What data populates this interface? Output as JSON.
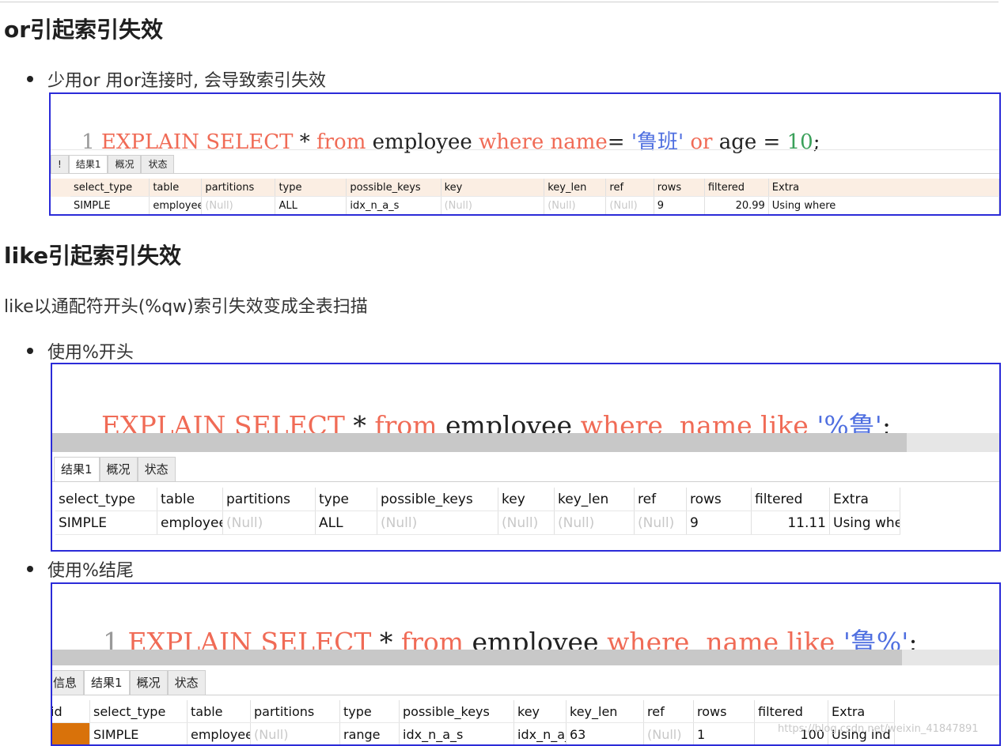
{
  "section1": {
    "heading": "or引起索引失效",
    "bullet": "少用or 用or连接时, 会导致索引失效",
    "shot": {
      "line_no": "1",
      "sql": [
        {
          "t": "EXPLAIN",
          "c": "kw"
        },
        {
          "t": " ",
          "c": "op"
        },
        {
          "t": "SELECT",
          "c": "kw"
        },
        {
          "t": " * ",
          "c": "op"
        },
        {
          "t": "from",
          "c": "kw"
        },
        {
          "t": " employee ",
          "c": "op"
        },
        {
          "t": "where",
          "c": "kw"
        },
        {
          "t": " ",
          "c": "op"
        },
        {
          "t": "name",
          "c": "kw"
        },
        {
          "t": "= ",
          "c": "op"
        },
        {
          "t": "'鲁班'",
          "c": "str"
        },
        {
          "t": " ",
          "c": "op"
        },
        {
          "t": "or",
          "c": "kw"
        },
        {
          "t": " age = ",
          "c": "op"
        },
        {
          "t": "10",
          "c": "num"
        },
        {
          "t": ";",
          "c": "op"
        }
      ],
      "tabs": [
        "!",
        "结果1",
        "概况",
        "状态"
      ],
      "columns": [
        "select_type",
        "table",
        "partitions",
        "type",
        "possible_keys",
        "key",
        "key_len",
        "ref",
        "rows",
        "filtered",
        "Extra"
      ],
      "row": [
        "SIMPLE",
        "employee",
        "(Null)",
        "ALL",
        "idx_n_a_s",
        "(Null)",
        "(Null)",
        "(Null)",
        "9",
        "20.99",
        "Using where"
      ]
    }
  },
  "section2": {
    "heading": "like引起索引失效",
    "para": "like以通配符开头(%qw)索引失效变成全表扫描",
    "bullet_a": "使用%开头",
    "shot_a": {
      "sql": [
        {
          "t": "EXPLAIN",
          "c": "kw"
        },
        {
          "t": " ",
          "c": "op"
        },
        {
          "t": "SELECT",
          "c": "kw"
        },
        {
          "t": " * ",
          "c": "op"
        },
        {
          "t": "from",
          "c": "kw"
        },
        {
          "t": " employee ",
          "c": "op"
        },
        {
          "t": "where",
          "c": "kw"
        },
        {
          "t": "  ",
          "c": "op"
        },
        {
          "t": "name",
          "c": "kw"
        },
        {
          "t": " ",
          "c": "op"
        },
        {
          "t": "like",
          "c": "kw"
        },
        {
          "t": " ",
          "c": "op"
        },
        {
          "t": "'%鲁'",
          "c": "str"
        },
        {
          "t": ";",
          "c": "op"
        }
      ],
      "tabs": [
        "结果1",
        "概况",
        "状态"
      ],
      "columns": [
        "select_type",
        "table",
        "partitions",
        "type",
        "possible_keys",
        "key",
        "key_len",
        "ref",
        "rows",
        "filtered",
        "Extra"
      ],
      "row": [
        "SIMPLE",
        "employee",
        "(Null)",
        "ALL",
        "(Null)",
        "(Null)",
        "(Null)",
        "(Null)",
        "9",
        "11.11",
        "Using whe"
      ]
    },
    "bullet_b": "使用%结尾",
    "shot_b": {
      "line_no": "1",
      "sql": [
        {
          "t": "EXPLAIN",
          "c": "kw"
        },
        {
          "t": " ",
          "c": "op"
        },
        {
          "t": "SELECT",
          "c": "kw"
        },
        {
          "t": " * ",
          "c": "op"
        },
        {
          "t": "from",
          "c": "kw"
        },
        {
          "t": " employee ",
          "c": "op"
        },
        {
          "t": "where",
          "c": "kw"
        },
        {
          "t": "  ",
          "c": "op"
        },
        {
          "t": "name",
          "c": "kw"
        },
        {
          "t": " ",
          "c": "op"
        },
        {
          "t": "like",
          "c": "kw"
        },
        {
          "t": " ",
          "c": "op"
        },
        {
          "t": "'鲁%'",
          "c": "str"
        },
        {
          "t": ";",
          "c": "op"
        }
      ],
      "tabs": [
        "信息",
        "结果1",
        "概况",
        "状态"
      ],
      "columns": [
        "id",
        "select_type",
        "table",
        "partitions",
        "type",
        "possible_keys",
        "key",
        "key_len",
        "ref",
        "rows",
        "filtered",
        "Extra"
      ],
      "row": [
        "",
        "SIMPLE",
        "employee",
        "(Null)",
        "range",
        "idx_n_a_s",
        "idx_n_a_s",
        "63",
        "(Null)",
        "1",
        "100",
        "Using ind"
      ]
    }
  },
  "watermark": "https://blog.csdn.net/weixin_41847891",
  "colors": {
    "frame": "#2b2bd8",
    "keyword": "#f06b56",
    "string": "#4f6fe0",
    "number": "#3aa05a",
    "id_cell": "#d9720a"
  }
}
